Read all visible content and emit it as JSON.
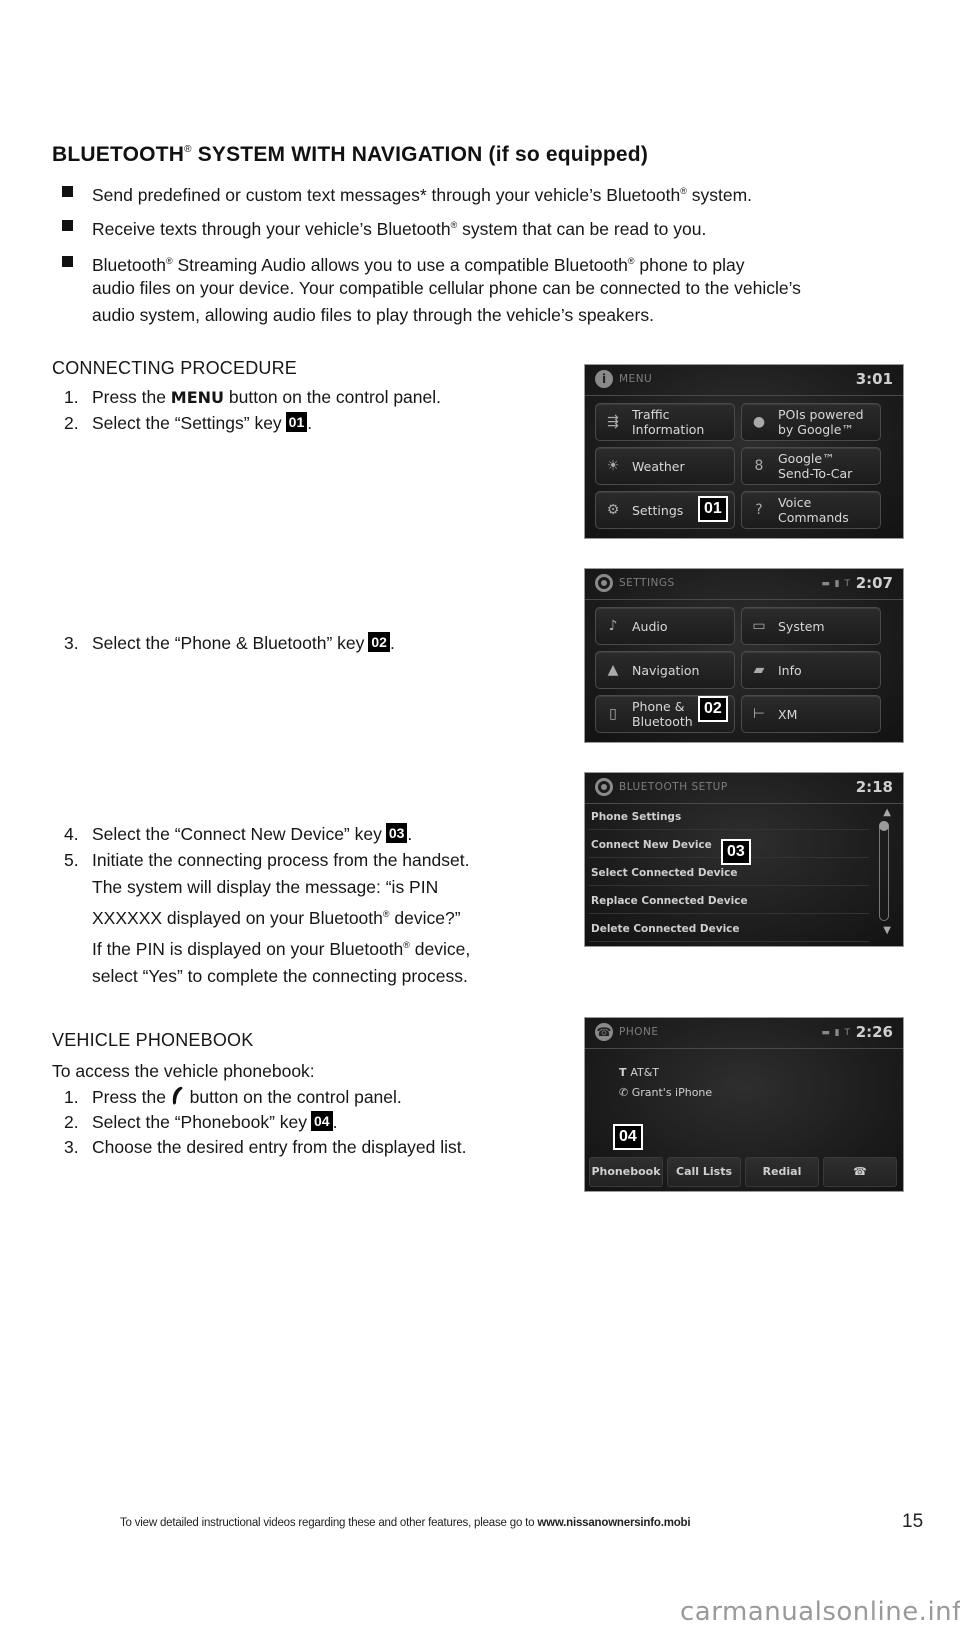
{
  "heading": {
    "prefix": "BLUETOOTH",
    "reg": "®",
    "suffix": " SYSTEM WITH NAVIGATION (if so equipped)"
  },
  "bullets": [
    {
      "lines": [
        "Send predefined or custom text messages* through your vehicle’s Bluetooth® system."
      ]
    },
    {
      "lines": [
        "Receive texts through your vehicle’s Bluetooth® system that can be read to you."
      ]
    },
    {
      "lines": [
        "Bluetooth® Streaming Audio allows you to use a compatible Bluetooth® phone to play",
        "audio files on your device. Your compatible cellular phone can be connected to the vehicle’s",
        "audio system, allowing audio files to play through the vehicle’s speakers."
      ]
    }
  ],
  "connecting": {
    "title": "CONNECTING PROCEDURE",
    "steps": [
      {
        "num": "1.",
        "before": "Press the ",
        "bold": "MENU",
        "after": " button on the control panel."
      },
      {
        "num": "2.",
        "text": "Select the “Settings” key",
        "badge": "01",
        "end": "."
      },
      {
        "num": "3.",
        "text": "Select the “Phone & Bluetooth” key",
        "badge": "02",
        "end": "."
      },
      {
        "num": "4.",
        "text": "Select the “Connect New Device” key",
        "badge": "03",
        "end": "."
      },
      {
        "num": "5.",
        "lines": [
          "Initiate the connecting process from the handset.",
          "The system will display the message: “is PIN",
          "XXXXXX displayed on your Bluetooth® device?”",
          "If the PIN is displayed on your Bluetooth® device,",
          "select “Yes” to complete the connecting process."
        ]
      }
    ]
  },
  "phonebook": {
    "title": "VEHICLE PHONEBOOK",
    "intro": "To access the vehicle phonebook:",
    "steps": [
      {
        "num": "1.",
        "before": "Press the ",
        "icon": "phone-handset-icon",
        "after": " button on the control panel."
      },
      {
        "num": "2.",
        "text": "Select the “Phonebook” key",
        "badge": "04",
        "end": "."
      },
      {
        "num": "3.",
        "text": "Choose the desired entry from the displayed list."
      }
    ]
  },
  "screens": {
    "menu": {
      "title": "MENU",
      "time": "3:01",
      "callout": "01",
      "tiles": [
        {
          "icon": "traffic-icon",
          "label1": "Traffic",
          "label2": "Information"
        },
        {
          "icon": "poi-pin-icon",
          "label1": "POIs powered",
          "label2": "by Google™"
        },
        {
          "icon": "weather-icon",
          "label1": "Weather"
        },
        {
          "icon": "google-send-icon",
          "label1": "Google™",
          "label2": "Send-To-Car"
        },
        {
          "icon": "settings-gear-icon",
          "label1": "Settings"
        },
        {
          "icon": "voice-commands-icon",
          "label1": "Voice",
          "label2": "Commands"
        }
      ]
    },
    "settings": {
      "title": "SETTINGS",
      "time": "2:07",
      "status": "▬ ▮ T",
      "callout": "02",
      "tiles": [
        {
          "icon": "music-note-icon",
          "label1": "Audio"
        },
        {
          "icon": "system-screen-icon",
          "label1": "System"
        },
        {
          "icon": "navigation-arrow-icon",
          "label1": "Navigation"
        },
        {
          "icon": "info-car-icon",
          "label1": "Info"
        },
        {
          "icon": "mobile-phone-icon",
          "label1": "Phone &",
          "label2": "Bluetooth"
        },
        {
          "icon": "xm-antenna-icon",
          "label1": "XM"
        }
      ]
    },
    "bluetooth": {
      "title": "BLUETOOTH SETUP",
      "time": "2:18",
      "callout": "03",
      "items": [
        "Phone Settings",
        "Connect New Device",
        "Select Connected Device",
        "Replace Connected Device",
        "Delete Connected Device"
      ]
    },
    "phone": {
      "title": "PHONE",
      "time": "2:26",
      "status": "▬ ▮ T",
      "callout": "04",
      "carrier": "AT&T",
      "device": "Grant's iPhone",
      "buttons": [
        "Phonebook",
        "Call Lists",
        "Redial",
        "☎"
      ]
    }
  },
  "footer": {
    "text": "To view detailed instructional videos regarding these and other features, please go to ",
    "link": "www.nissanownersinfo.mobi",
    "page": "15"
  },
  "watermark": "carmanualsonline.info"
}
